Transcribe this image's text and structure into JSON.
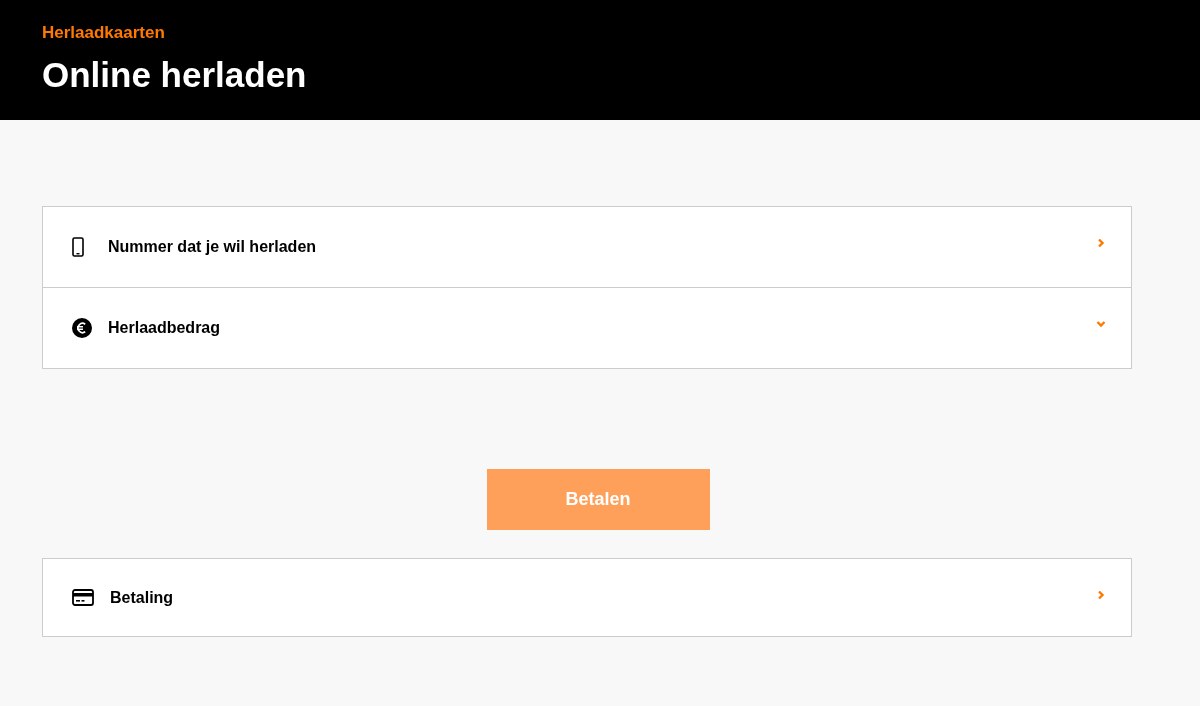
{
  "header": {
    "eyebrow": "Herlaadkaarten",
    "title": "Online herladen"
  },
  "steps": [
    {
      "kind": "phone",
      "label": "Nummer dat je wil herladen",
      "expanded": false
    },
    {
      "kind": "amount",
      "label": "Herlaadbedrag",
      "expanded": true
    }
  ],
  "pay_button": {
    "label": "Betalen",
    "disabled": true
  },
  "payment_steps": [
    {
      "kind": "card",
      "label": "Betaling",
      "expanded": false
    }
  ]
}
